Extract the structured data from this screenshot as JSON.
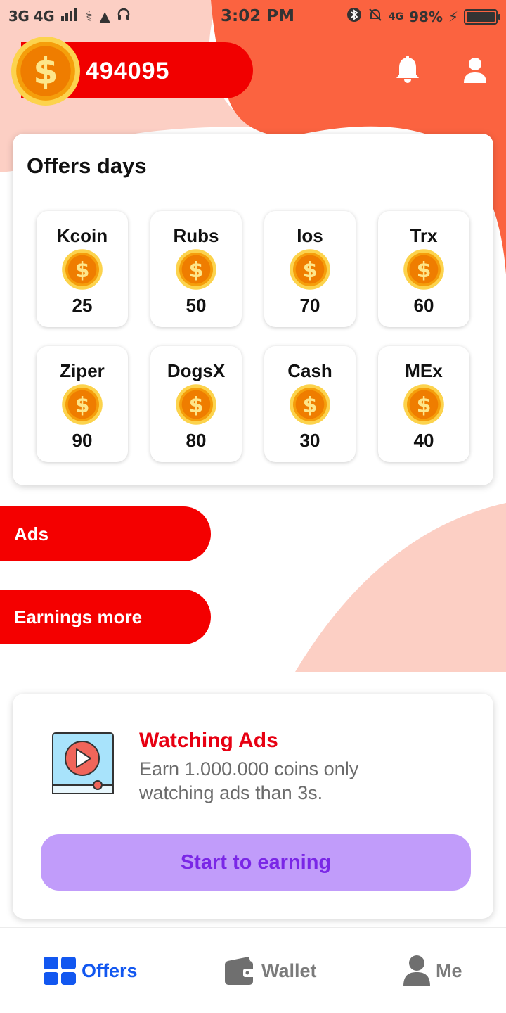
{
  "status_bar": {
    "left": "3G 4G",
    "time": "3:02 PM",
    "network": "4G",
    "battery": "98%"
  },
  "header": {
    "balance": "494095",
    "coin_icon": "dollar-coin-icon",
    "bell_icon": "bell-icon",
    "user_icon": "user-icon"
  },
  "offers": {
    "title": "Offers days",
    "items": [
      {
        "name": "Kcoin",
        "value": "25"
      },
      {
        "name": "Rubs",
        "value": "50"
      },
      {
        "name": "Ios",
        "value": "70"
      },
      {
        "name": "Trx",
        "value": "60"
      },
      {
        "name": "Ziper",
        "value": "90"
      },
      {
        "name": "DogsX",
        "value": "80"
      },
      {
        "name": "Cash",
        "value": "30"
      },
      {
        "name": "MEx",
        "value": "40"
      }
    ]
  },
  "buttons": {
    "ads": "Ads",
    "earnings_more": "Earnings more"
  },
  "watch_card": {
    "title": "Watching Ads",
    "description": "Earn 1.000.000 coins only watching ads than 3s.",
    "cta": "Start to earning",
    "icon": "video-play-icon"
  },
  "bottom_nav": {
    "offers": "Offers",
    "wallet": "Wallet",
    "me": "Me",
    "active": "Offers"
  },
  "colors": {
    "primary_red": "#f10000",
    "orange_bg": "#fb6340",
    "peach_bg": "#fccfc4",
    "cta_bg": "#c19cfa",
    "cta_text": "#7a27e6",
    "nav_active": "#1257f0",
    "nav_inactive": "#7b7b7b"
  }
}
